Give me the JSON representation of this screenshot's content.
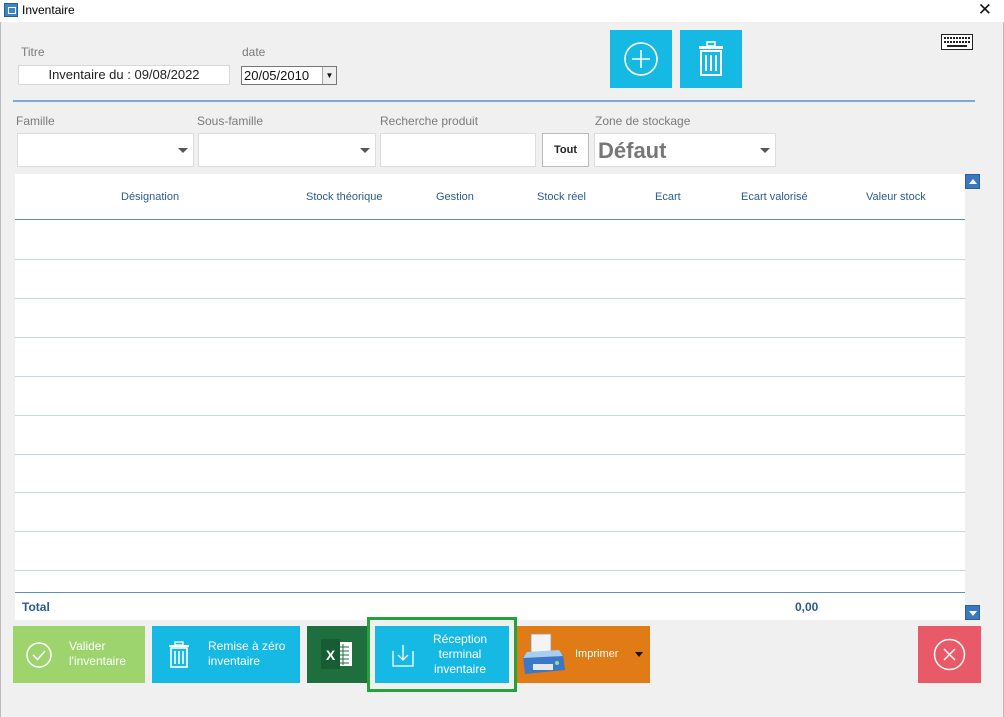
{
  "window": {
    "title": "Inventaire",
    "close_glyph": "✕"
  },
  "header": {
    "titre_label": "Titre",
    "titre_value": "Inventaire du : 09/08/2022",
    "date_label": "date",
    "date_value": "20/05/2010"
  },
  "filters": {
    "famille_label": "Famille",
    "sous_famille_label": "Sous-famille",
    "recherche_label": "Recherche produit",
    "tout_label": "Tout",
    "zone_label": "Zone de stockage",
    "zone_value": "Défaut"
  },
  "grid": {
    "columns": [
      "Désignation",
      "Stock théorique",
      "Gestion",
      "Stock réel",
      "Ecart",
      "Ecart valorisé",
      "Valeur stock"
    ],
    "total_label": "Total",
    "total_value": "0,00"
  },
  "buttons": {
    "valider": "Valider\nl'inventaire",
    "remise": "Remise à zéro\ninventaire",
    "reception": "Réception\nterminal\ninventaire",
    "imprimer": "Imprimer"
  },
  "icons": {
    "add": "plus-circle-icon",
    "delete": "trash-icon",
    "keyboard": "keyboard-icon",
    "valider": "check-circle-icon",
    "remise": "trash-icon",
    "excel": "excel-icon",
    "reception": "download-tray-icon",
    "imprimer": "printer-icon",
    "close": "close-circle-icon"
  },
  "colors": {
    "accent": "#16b9e3",
    "valider": "#9ed46e",
    "imprimer": "#e17b15",
    "close": "#e85a67",
    "excel": "#1e6e3e",
    "highlight": "#22a33c"
  }
}
